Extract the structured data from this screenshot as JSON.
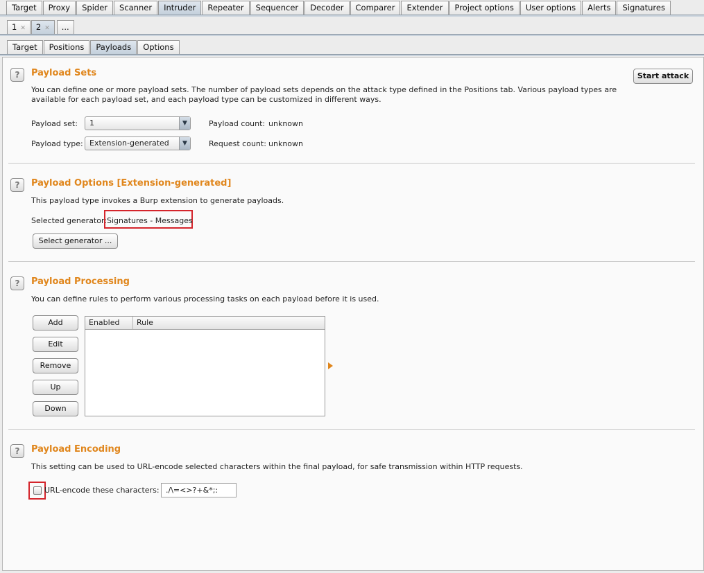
{
  "main_tabs": [
    "Target",
    "Proxy",
    "Spider",
    "Scanner",
    "Intruder",
    "Repeater",
    "Sequencer",
    "Decoder",
    "Comparer",
    "Extender",
    "Project options",
    "User options",
    "Alerts",
    "Signatures"
  ],
  "instance_tabs": {
    "tab1": "1",
    "tab2": "2",
    "more": "..."
  },
  "sub_tabs": [
    "Target",
    "Positions",
    "Payloads",
    "Options"
  ],
  "payload_sets": {
    "title": "Payload Sets",
    "description": "You can define one or more payload sets. The number of payload sets depends on the attack type defined in the Positions tab. Various payload types are available for each payload set, and each payload type can be customized in different ways.",
    "set_label": "Payload set:",
    "set_value": "1",
    "type_label": "Payload type:",
    "type_value": "Extension-generated",
    "count_label": "Payload count:",
    "count_value": "unknown",
    "request_label": "Request count:",
    "request_value": "unknown",
    "start_button": "Start attack"
  },
  "payload_options": {
    "title": "Payload Options [Extension-generated]",
    "description": "This payload type invokes a Burp extension to generate payloads.",
    "generator_label": "Selected generator:",
    "generator_value": "Signatures - Messages",
    "select_button": "Select generator ..."
  },
  "payload_processing": {
    "title": "Payload Processing",
    "description": "You can define rules to perform various processing tasks on each payload before it is used.",
    "buttons": {
      "add": "Add",
      "edit": "Edit",
      "remove": "Remove",
      "up": "Up",
      "down": "Down"
    },
    "columns": {
      "enabled": "Enabled",
      "rule": "Rule"
    }
  },
  "payload_encoding": {
    "title": "Payload Encoding",
    "description": "This setting can be used to URL-encode selected characters within the final payload, for safe transmission within HTTP requests.",
    "checkbox_label": "URL-encode these characters:",
    "characters": "./\\=<>?+&*;:"
  },
  "help_glyph": "?",
  "colors": {
    "accent": "#e0861c",
    "highlight": "#d4242b"
  }
}
